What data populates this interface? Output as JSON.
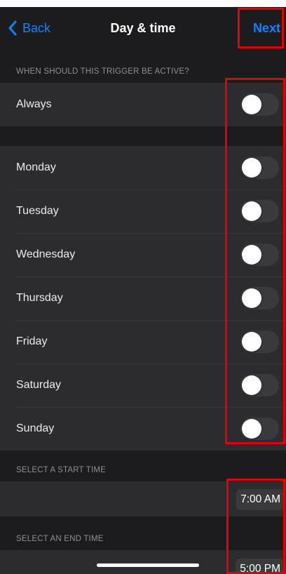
{
  "nav": {
    "back_label": "Back",
    "title": "Day & time",
    "next_label": "Next"
  },
  "trigger_section": {
    "header": "WHEN SHOULD THIS TRIGGER BE ACTIVE?",
    "always": {
      "label": "Always",
      "on": false
    }
  },
  "days": [
    {
      "label": "Monday",
      "on": false
    },
    {
      "label": "Tuesday",
      "on": false
    },
    {
      "label": "Wednesday",
      "on": false
    },
    {
      "label": "Thursday",
      "on": false
    },
    {
      "label": "Friday",
      "on": false
    },
    {
      "label": "Saturday",
      "on": false
    },
    {
      "label": "Sunday",
      "on": false
    }
  ],
  "start_time": {
    "header": "SELECT A START TIME",
    "value": "7:00 AM"
  },
  "end_time": {
    "header": "SELECT AN END TIME",
    "value": "5:00 PM"
  },
  "colors": {
    "accent": "#0a84ff",
    "background": "#1c1c1e",
    "cell": "#2c2c2e",
    "highlight": "#e00000"
  }
}
